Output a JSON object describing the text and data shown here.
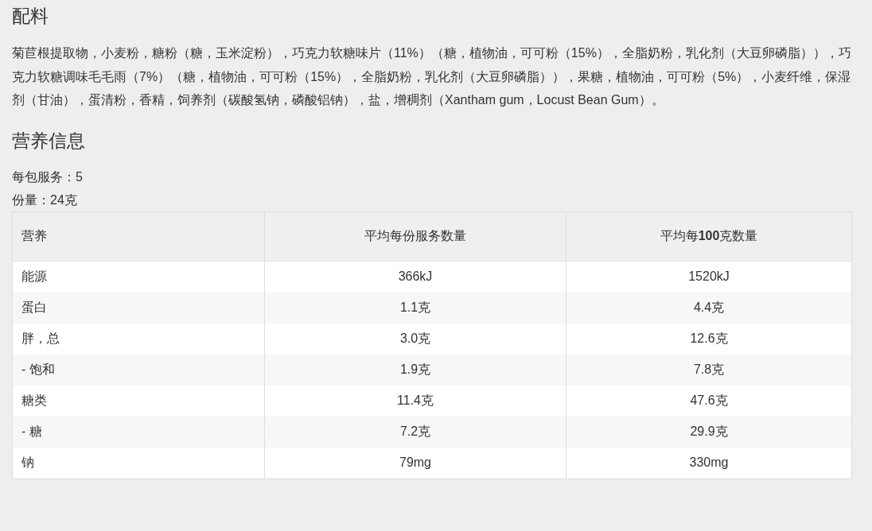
{
  "ingredients": {
    "heading": "配料",
    "text": "菊苣根提取物，小麦粉，糖粉（糖，玉米淀粉），巧克力软糖味片（11%）（糖，植物油，可可粉（15%），全脂奶粉，乳化剂（大豆卵磷脂）），巧克力软糖调味毛毛雨（7%）（糖，植物油，可可粉（15%），全脂奶粉，乳化剂（大豆卵磷脂）），果糖，植物油，可可粉（5%），小麦纤维，保湿剂（甘油），蛋清粉，香精，饲养剂（碳酸氢钠，磷酸铝钠），盐，增稠剂（Xantham gum，Locust Bean Gum）。"
  },
  "nutrition": {
    "heading": "营养信息",
    "servings_per_pack": "每包服务：5",
    "serving_size": "份量：24克",
    "table": {
      "columns": [
        "营养",
        "平均每份服务数量",
        "平均每**100**克数量"
      ],
      "rows": [
        [
          "能源",
          "366kJ",
          "1520kJ"
        ],
        [
          "蛋白",
          "1.1克",
          "4.4克"
        ],
        [
          "胖，总",
          "3.0克",
          "12.6克"
        ],
        [
          "- 饱和",
          "1.9克",
          "7.8克"
        ],
        [
          "糖类",
          "11.4克",
          "47.6克"
        ],
        [
          "- 糖",
          "7.2克",
          "29.9克"
        ],
        [
          "钠",
          "79mg",
          "330mg"
        ]
      ]
    }
  }
}
